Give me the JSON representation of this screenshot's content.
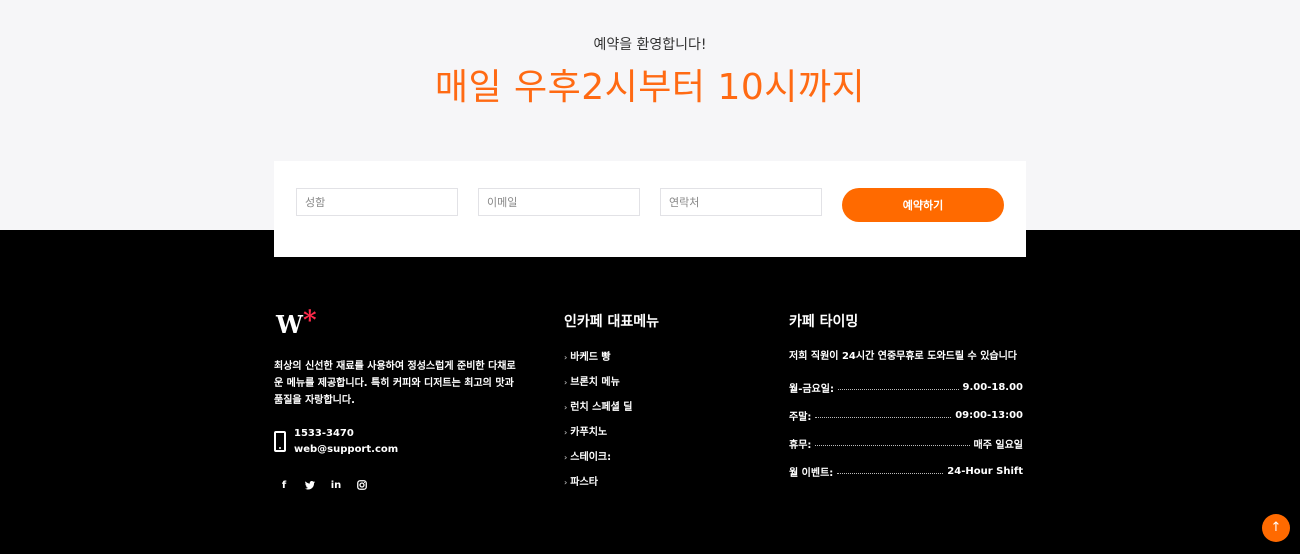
{
  "hero": {
    "subtitle": "예약을 환영합니다!",
    "title": "매일 우후2시부터 10시까지"
  },
  "reservation_form": {
    "name_placeholder": "성함",
    "email_placeholder": "이메일",
    "phone_placeholder": "연락처",
    "submit_label": "예약하기"
  },
  "footer": {
    "logo_text": "W",
    "logo_mark": "*",
    "about": "최상의 신선한 재료를 사용하여 정성스럽게 준비한 다채로운 메뉴를 제공합니다. 특히 커피와 디저트는 최고의 맛과 품질을 자랑합니다.",
    "phone": "1533-3470",
    "email": "web@support.com",
    "social": [
      {
        "icon": "facebook-icon",
        "glyph": "f"
      },
      {
        "icon": "twitter-icon",
        "glyph": "🐦"
      },
      {
        "icon": "linkedin-icon",
        "glyph": "in"
      },
      {
        "icon": "instagram-icon",
        "glyph": "◎"
      }
    ],
    "menu": {
      "title": "인카페 대표메뉴",
      "items": [
        "바케드 빵",
        "브론치 메뉴",
        "런치 스페셜 딜",
        "카푸치노",
        "스테이크:",
        "파스타"
      ]
    },
    "hours": {
      "title": "카페 타이밍",
      "intro": "저희 직원이 24시간 연중무휴로 도와드릴 수 있습니다",
      "rows": [
        {
          "label": "월-금요일:",
          "value": "9.00-18.00"
        },
        {
          "label": "주말:",
          "value": "09:00-13:00"
        },
        {
          "label": "휴무:",
          "value": "매주 일요일"
        },
        {
          "label": "월 이벤트:",
          "value": "24-Hour Shift"
        }
      ]
    }
  },
  "scroll_top": {
    "glyph": "↑"
  },
  "colors": {
    "accent": "#ff6a00",
    "title": "#ff6a13",
    "logo_mark": "#ff2a4a",
    "hero_bg": "#f6f6f8",
    "footer_bg": "#000000"
  }
}
